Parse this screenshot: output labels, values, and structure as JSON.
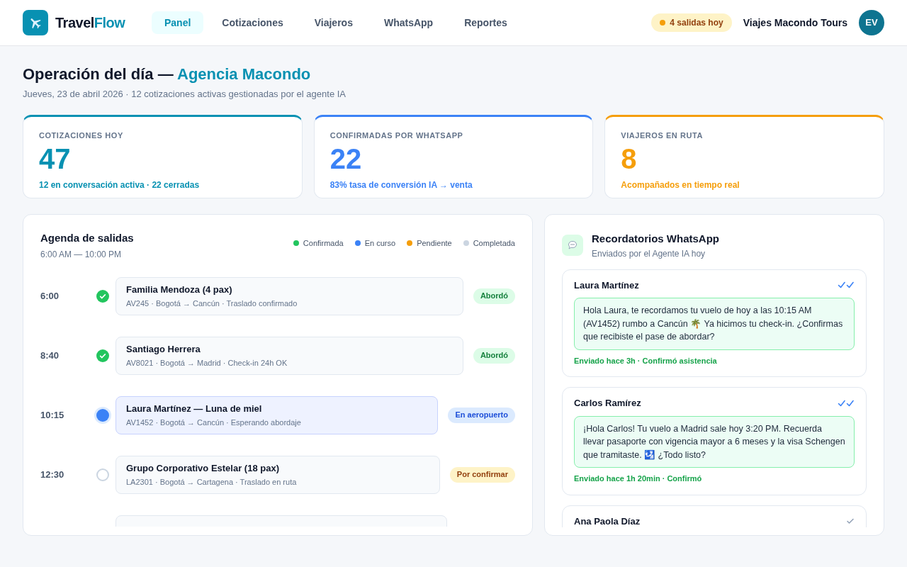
{
  "brand": {
    "prefix": "Travel",
    "suffix": "Flow"
  },
  "nav": [
    {
      "label": "Panel",
      "selected": true
    },
    {
      "label": "Cotizaciones",
      "selected": false
    },
    {
      "label": "Viajeros",
      "selected": false
    },
    {
      "label": "WhatsApp",
      "selected": false
    },
    {
      "label": "Reportes",
      "selected": false
    }
  ],
  "header_badge": "4 salidas hoy",
  "agency": "Viajes Macondo Tours",
  "avatar": "EV",
  "page": {
    "title": "Operación del día — ",
    "title_accent": "Agencia Macondo",
    "subtitle": "Jueves, 23 de abril 2026 · 12 cotizaciones activas gestionadas por el agente IA"
  },
  "kpis": [
    {
      "label": "COTIZACIONES HOY",
      "value": "47",
      "note": "12 en conversación activa · 22 cerradas",
      "color": "#0891b2"
    },
    {
      "label": "CONFIRMADAS POR WHATSAPP",
      "value": "22",
      "note": "83% tasa de conversión IA → venta",
      "color": "#3b82f6"
    },
    {
      "label": "VIAJEROS EN RUTA",
      "value": "8",
      "note": "Acompañados en tiempo real",
      "color": "#f59e0b"
    }
  ],
  "schedule": {
    "title": "Agenda de salidas",
    "range": "6:00 AM — 10:00 PM",
    "legend": [
      {
        "label": "Confirmada",
        "color": "#22c55e"
      },
      {
        "label": "En curso",
        "color": "#3b82f6"
      },
      {
        "label": "Pendiente",
        "color": "#f59e0b"
      },
      {
        "label": "Completada",
        "color": "#cbd5e1"
      }
    ],
    "items": [
      {
        "time": "6:00",
        "kind": "done",
        "title": "Familia Mendoza (4 pax)",
        "detail": "AV245 · Bogotá → Cancún · Traslado confirmado",
        "badge": "Abordó"
      },
      {
        "time": "8:40",
        "kind": "done",
        "title": "Santiago Herrera",
        "detail": "AV8021 · Bogotá → Madrid · Check-in 24h OK",
        "badge": "Abordó"
      },
      {
        "time": "10:15",
        "kind": "current",
        "title": "Laura Martínez — Luna de miel",
        "detail": "AV1452 · Bogotá → Cancún · Esperando abordaje",
        "badge": "En aeropuerto"
      },
      {
        "time": "12:30",
        "kind": "pending",
        "title": "Grupo Corporativo Estelar (18 pax)",
        "detail": "LA2301 · Bogotá → Cartagena · Traslado en ruta",
        "badge": "Por confirmar"
      },
      {
        "kind": "cut"
      }
    ]
  },
  "reminders": {
    "title": "Recordatorios WhatsApp",
    "subtitle": "Enviados por el Agente IA hoy",
    "messages": [
      {
        "name": "Laura Martínez",
        "read": true,
        "text": "Hola Laura, te recordamos tu vuelo de hoy a las 10:15 AM (AV1452) rumbo a Cancún 🌴 Ya hicimos tu check-in. ¿Confirmas que recibiste el pase de abordar?",
        "status": "Enviado hace 3h · Confirmó asistencia"
      },
      {
        "name": "Carlos Ramírez",
        "read": true,
        "text": "¡Hola Carlos! Tu vuelo a Madrid sale hoy 3:20 PM. Recuerda llevar pasaporte con vigencia mayor a 6 meses y la visa Schengen que tramitaste. 🛂 ¿Todo listo?",
        "status": "Enviado hace 1h 20min · Confirmó"
      },
      {
        "name": "Ana Paola Díaz",
        "read": false
      }
    ]
  }
}
